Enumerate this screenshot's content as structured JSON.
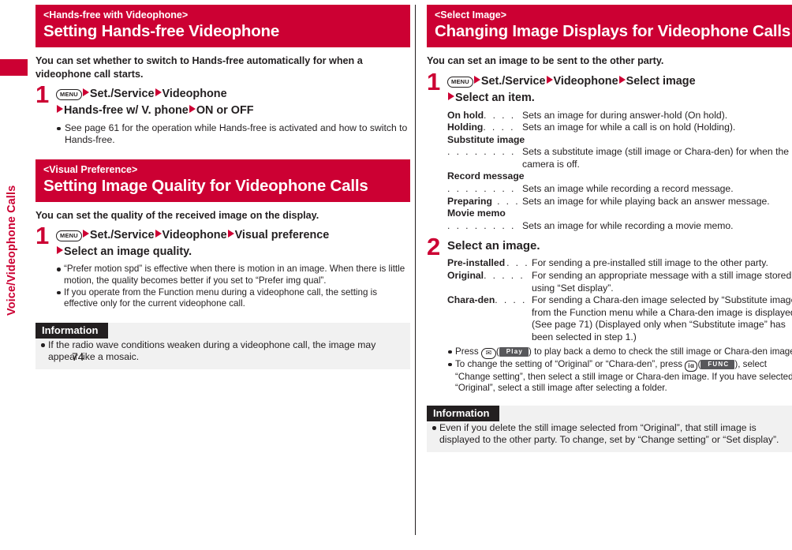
{
  "colors": {
    "brand_red": "#CC0033",
    "ink": "#231f20",
    "info_bg": "#F1F1F1",
    "softkey_bg": "#58585b"
  },
  "sidebar": {
    "chapter_label": "Voice/Videophone Calls"
  },
  "footer": {
    "page_number": "74"
  },
  "left_column": {
    "section1": {
      "eyebrow": "<Hands-free with Videophone>",
      "title": "Setting Hands-free Videophone",
      "lead": "You can set whether to switch to Hands-free automatically for when a videophone call starts.",
      "step": {
        "number": "1",
        "key_label": "MENU",
        "path_part1": "Set./Service",
        "path_part2": "Videophone",
        "path_part3": "Hands-free w/ V. phone",
        "path_part4": "ON or OFF"
      },
      "notes": [
        "See page 61 for the operation while Hands-free is activated and how to switch to Hands-free."
      ]
    },
    "section2": {
      "eyebrow": "<Visual Preference>",
      "title": "Setting Image Quality for Videophone Calls",
      "lead": "You can set the quality of the received image on the display.",
      "step": {
        "number": "1",
        "key_label": "MENU",
        "path_part1": "Set./Service",
        "path_part2": "Videophone",
        "path_part3": "Visual preference",
        "path_part4": "Select an image quality."
      },
      "notes": [
        "“Prefer motion spd” is effective when there is motion in an image. When there is little motion, the quality becomes better if you set to “Prefer img qual”.",
        "If you operate from the Function menu during a videophone call, the setting is effective only for the current videophone call."
      ],
      "information": {
        "title": "Information",
        "items": [
          "If the radio wave conditions weaken during a videophone call, the image may appear like a mosaic."
        ]
      }
    }
  },
  "right_column": {
    "section1": {
      "eyebrow": "<Select Image>",
      "title": "Changing Image Displays for Videophone Calls",
      "lead": "You can set an image to be sent to the other party.",
      "step1": {
        "number": "1",
        "key_label": "MENU",
        "path_part1": "Set./Service",
        "path_part2": "Videophone",
        "path_part3": "Select image",
        "path_part4": "Select an item.",
        "definitions": [
          {
            "term": "On hold",
            "leader": ". . . . .",
            "desc": "Sets an image for during answer-hold (On hold).",
            "standalone": false
          },
          {
            "term": "Holding",
            "leader": ". . . . .",
            "desc": "Sets an image for while a call is on hold (Holding).",
            "standalone": false
          },
          {
            "term": "Substitute image",
            "leader": ". . . . . . . . . . . .",
            "desc": "Sets a substitute image (still image or Chara-den) for when the camera is off.",
            "standalone": true
          },
          {
            "term": "Record message",
            "leader": ". . . . . . . . . . . .",
            "desc": "Sets an image while recording a record message.",
            "standalone": true
          },
          {
            "term": "Preparing",
            "leader": ". . .",
            "desc": "Sets an image for while playing back an answer message.",
            "standalone": false
          },
          {
            "term": "Movie memo",
            "leader": ". . . . . . . . . . . .",
            "desc": "Sets an image for while recording a movie memo.",
            "standalone": true
          }
        ]
      },
      "step2": {
        "number": "2",
        "title": "Select an image.",
        "definitions": [
          {
            "term": "Pre-installed",
            "leader": ". . .",
            "desc": "For sending a pre-installed still image to the other party.",
            "standalone": false
          },
          {
            "term": "Original",
            "leader": ". . . . . . .",
            "desc": "For sending an appropriate message with a still image stored using “Set display”.",
            "standalone": false
          },
          {
            "term": "Chara-den",
            "leader": ". . . . .",
            "desc": "For sending a Chara-den image selected by “Substitute image” from the Function menu while a Chara-den image is displayed. (See page 71) (Displayed only when “Substitute image” has been selected in step 1.)",
            "standalone": false
          }
        ],
        "notes": {
          "note1_before": "Press",
          "note1_key": "✉",
          "note1_softkey": "Play",
          "note1_after": ") to play back a demo to check the still image or Chara-den image.",
          "note2_before": "To change the setting of “Original” or “Chara-den”, press",
          "note2_key": "iα",
          "note2_softkey": "FUNC",
          "note2_after": "), select “Change setting”, then select a still image or Chara-den image. If you have selected “Original”, select a still image after selecting a folder."
        }
      },
      "information": {
        "title": "Information",
        "items": [
          "Even if you delete the still image selected from “Original”, that still image is displayed to the other party. To change, set by “Change setting” or “Set display”."
        ]
      }
    }
  }
}
